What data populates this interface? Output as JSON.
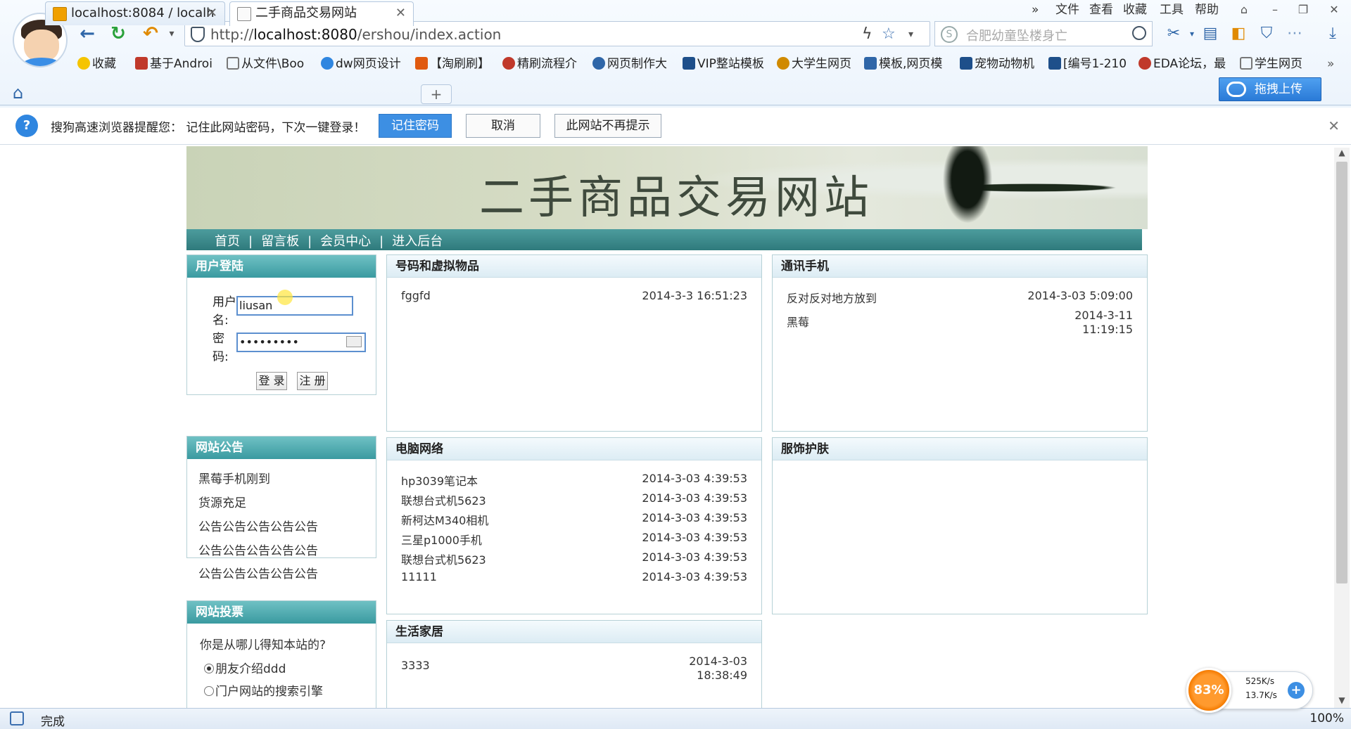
{
  "browser": {
    "menu": [
      "文件",
      "查看",
      "收藏",
      "工具",
      "帮助"
    ],
    "url_prefix": "http://",
    "url_host": "localhost:8080",
    "url_path": "/ershou/index.action",
    "search_placeholder": "合肥幼童坠楼身亡",
    "bookmarks": [
      "收藏",
      "基于Androi",
      "从文件\\Boo",
      "dw网页设计",
      "【淘刷刷】",
      "精刷流程介",
      "网页制作大",
      "VIP整站模板",
      "大学生网页",
      "模板,网页模",
      "宠物动物机",
      "[编号1-210",
      "EDA论坛，最",
      "学生网页"
    ],
    "tabs": [
      {
        "label": "localhost:8084 / localh"
      },
      {
        "label": "二手商品交易网站"
      }
    ],
    "upload_label": "拖拽上传",
    "notify": {
      "text": "搜狗高速浏览器提醒您：  记住此网站密码，下次一键登录！",
      "remember": "记住密码",
      "cancel": "取消",
      "never": "此网站不再提示"
    },
    "status": "完成",
    "zoom": "100%",
    "speed": {
      "percent": "83%",
      "up": "525K/s",
      "down": "13.7K/s"
    }
  },
  "site": {
    "title": "二手商品交易网站",
    "nav": [
      "首页",
      "留言板",
      "会员中心",
      "进入后台"
    ],
    "login": {
      "heading": "用户登陆",
      "user_label_1": "用户",
      "user_label_2": "名:",
      "username": "liusan",
      "pwd_label_1": "密",
      "pwd_label_2": "码:",
      "password_mask": "•••••••••",
      "login_btn": "登 录",
      "register_btn": "注 册"
    },
    "notices": {
      "heading": "网站公告",
      "items": [
        "黑莓手机刚到",
        "货源充足",
        "公告公告公告公告公告",
        "公告公告公告公告公告",
        "公告公告公告公告公告"
      ]
    },
    "vote": {
      "heading": "网站投票",
      "question": "你是从哪儿得知本站的?",
      "options": [
        "朋友介绍ddd",
        "门户网站的搜索引擎"
      ]
    },
    "categories": {
      "virtual": {
        "heading": "号码和虚拟物品",
        "items": [
          {
            "title": "fggfd",
            "date": "2014-3-3 16:51:23"
          }
        ]
      },
      "phone": {
        "heading": "通讯手机",
        "items": [
          {
            "title": "反对反对地方放到",
            "date": "2014-3-03 5:09:00"
          },
          {
            "title": "黑莓",
            "date1": "2014-3-11",
            "date2": "11:19:15"
          }
        ]
      },
      "computer": {
        "heading": "电脑网络",
        "items": [
          {
            "title": "hp3039笔记本",
            "date": "2014-3-03 4:39:53"
          },
          {
            "title": "联想台式机5623",
            "date": "2014-3-03 4:39:53"
          },
          {
            "title": "新柯达M340相机",
            "date": "2014-3-03 4:39:53"
          },
          {
            "title": "三星p1000手机",
            "date": "2014-3-03 4:39:53"
          },
          {
            "title": "联想台式机5623",
            "date": "2014-3-03 4:39:53"
          },
          {
            "title": "11111",
            "date": "2014-3-03 4:39:53"
          }
        ]
      },
      "clothing": {
        "heading": "服饰护肤"
      },
      "home": {
        "heading": "生活家居",
        "items": [
          {
            "title": "3333",
            "date1": "2014-3-03",
            "date2": "18:38:49"
          }
        ]
      }
    }
  }
}
